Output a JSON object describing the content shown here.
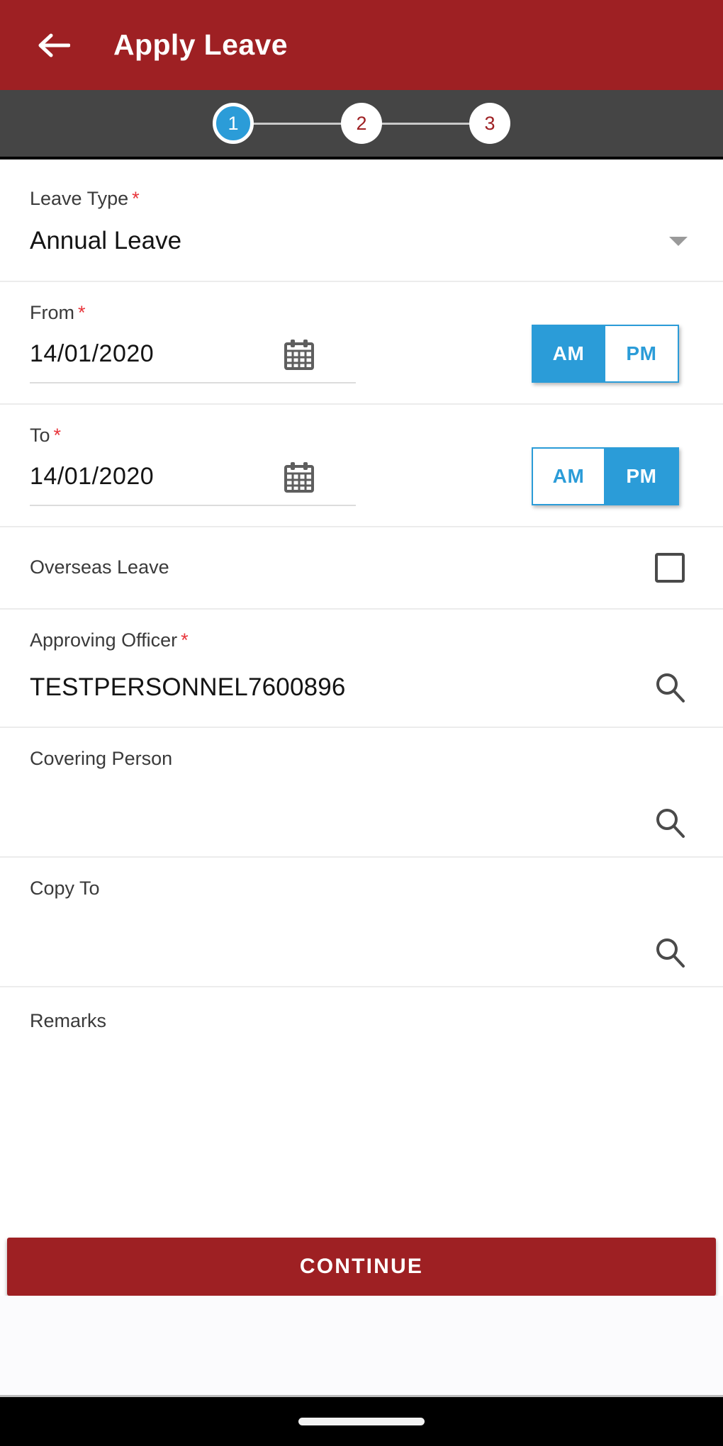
{
  "colors": {
    "brand_red": "#9e2023",
    "accent_blue": "#2b9cd8",
    "stepper_bar": "#454545",
    "required_asterisk": "#e8353b"
  },
  "appbar": {
    "title": "Apply Leave",
    "back_icon": "arrow-left-icon"
  },
  "stepper": {
    "steps": [
      {
        "label": "1",
        "state": "active"
      },
      {
        "label": "2",
        "state": "inactive"
      },
      {
        "label": "3",
        "state": "inactive"
      }
    ]
  },
  "form": {
    "leave_type": {
      "label": "Leave Type",
      "required_mark": "*",
      "value": "Annual Leave",
      "dropdown_icon": "chevron-down-icon"
    },
    "from": {
      "label": "From",
      "required_mark": "*",
      "value": "14/01/2020",
      "calendar_icon": "calendar-icon",
      "am_label": "AM",
      "pm_label": "PM",
      "selected": "AM"
    },
    "to": {
      "label": "To",
      "required_mark": "*",
      "value": "14/01/2020",
      "calendar_icon": "calendar-icon",
      "am_label": "AM",
      "pm_label": "PM",
      "selected": "PM"
    },
    "overseas_leave": {
      "label": "Overseas Leave",
      "checked": false
    },
    "approving_officer": {
      "label": "Approving Officer",
      "required_mark": "*",
      "value": "TESTPERSONNEL7600896",
      "search_icon": "search-icon"
    },
    "covering_person": {
      "label": "Covering Person",
      "value": "",
      "placeholder": "",
      "search_icon": "search-icon"
    },
    "copy_to": {
      "label": "Copy To",
      "value": "",
      "placeholder": "",
      "search_icon": "search-icon"
    },
    "remarks": {
      "label": "Remarks",
      "value": "",
      "placeholder": ""
    }
  },
  "footer": {
    "continue_label": "CONTINUE"
  },
  "navbar": {
    "home_indicator": "home-indicator"
  }
}
